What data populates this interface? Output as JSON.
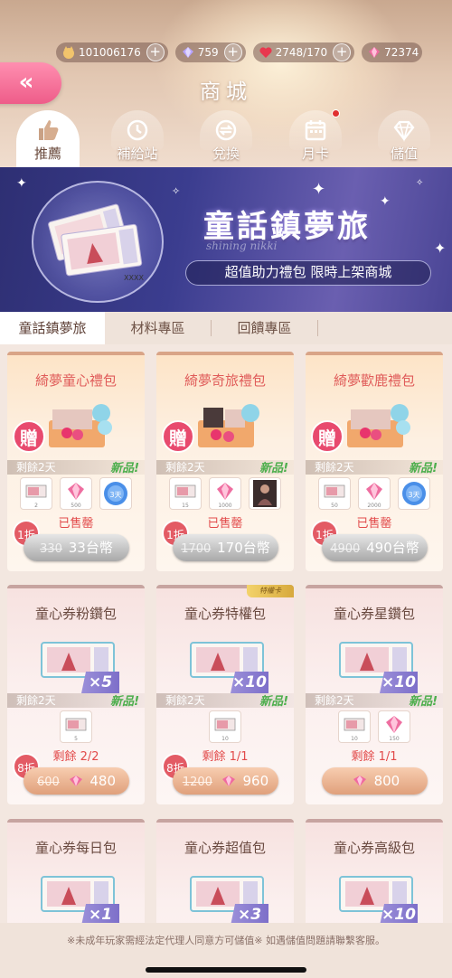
{
  "currency": {
    "player_id": "101006176",
    "diamonds": "759",
    "stamina": "2748/170",
    "pink_diamonds": "72374",
    "plus_symbol": "+"
  },
  "header": {
    "back_symbol": "«",
    "title": "商城"
  },
  "main_tabs": [
    {
      "label": "推薦",
      "icon": "thumbs-up-icon",
      "active": true
    },
    {
      "label": "補給站",
      "icon": "clock-icon",
      "active": false
    },
    {
      "label": "兌換",
      "icon": "exchange-icon",
      "active": false
    },
    {
      "label": "月卡",
      "icon": "calendar-icon",
      "active": false,
      "badge": true
    },
    {
      "label": "儲值",
      "icon": "diamond-icon",
      "active": false
    }
  ],
  "banner": {
    "title": "童話鎮夢旅",
    "script_text": "shining nikki",
    "subtitle": "超值助力禮包 限時上架商城",
    "ticket_text": "XXXX"
  },
  "sub_tabs": [
    {
      "label": "童話鎮夢旅",
      "active": true
    },
    {
      "label": "材料專區",
      "active": false
    },
    {
      "label": "回饋專區",
      "active": false
    }
  ],
  "packs_row1": [
    {
      "title": "綺夢童心禮包",
      "gift_badge": "贈",
      "remaining": "剩餘2天",
      "new_label": "新品!",
      "items": [
        {
          "icon": "ticket-icon",
          "qty": "2"
        },
        {
          "icon": "pink-diamond-icon",
          "qty": "500"
        },
        {
          "icon": "blue-badge-icon",
          "qty": "3天"
        }
      ],
      "status": "已售罄",
      "discount": "1折",
      "old_price": "330",
      "price": "33台幣"
    },
    {
      "title": "綺夢奇旅禮包",
      "gift_badge": "贈",
      "remaining": "剩餘2天",
      "new_label": "新品!",
      "items": [
        {
          "icon": "ticket-icon",
          "qty": "15"
        },
        {
          "icon": "pink-diamond-icon",
          "qty": "1000"
        },
        {
          "icon": "character-card-icon",
          "qty": ""
        }
      ],
      "status": "已售罄",
      "discount": "1折",
      "old_price": "1700",
      "price": "170台幣"
    },
    {
      "title": "綺夢歡鹿禮包",
      "gift_badge": "贈",
      "remaining": "剩餘2天",
      "new_label": "新品!",
      "items": [
        {
          "icon": "ticket-icon",
          "qty": "50"
        },
        {
          "icon": "pink-diamond-icon",
          "qty": "2000"
        },
        {
          "icon": "blue-badge-icon",
          "qty": "3天"
        }
      ],
      "status": "已售罄",
      "discount": "1折",
      "old_price": "4900",
      "price": "490台幣"
    }
  ],
  "packs_row2": [
    {
      "title": "童心券粉鑽包",
      "multiplier": "×5",
      "remaining": "剩餘2天",
      "new_label": "新品!",
      "item_icon": "ticket-icon",
      "item_qty": "5",
      "remain_count": "剩餘 2/2",
      "discount": "8折",
      "old_price": "600",
      "price": "480"
    },
    {
      "title": "童心券特權包",
      "ribbon": "特權卡",
      "multiplier": "×10",
      "remaining": "剩餘2天",
      "new_label": "新品!",
      "item_icon": "ticket-icon",
      "item_qty": "10",
      "remain_count": "剩餘 1/1",
      "discount": "8折",
      "old_price": "1200",
      "price": "960"
    },
    {
      "title": "童心券星鑽包",
      "multiplier": "×10",
      "remaining": "剩餘2天",
      "new_label": "新品!",
      "item_icons": [
        "ticket-icon",
        "pink-diamond-icon"
      ],
      "item_qtys": [
        "10",
        "150"
      ],
      "remain_count": "剩餘 1/1",
      "price": "800"
    }
  ],
  "packs_row3": [
    {
      "title": "童心券每日包",
      "multiplier": "×1"
    },
    {
      "title": "童心券超值包",
      "multiplier": "×3"
    },
    {
      "title": "童心券高級包",
      "multiplier": "×10"
    }
  ],
  "footer": {
    "notice": "※未成年玩家需經法定代理人同意方可儲值※ 如遇儲值問題請聯繫客服。"
  },
  "colors": {
    "accent_pink": "#ee5c89",
    "title_red": "#e05c5a",
    "new_green": "#4cae4c",
    "discount_red": "#e35b65"
  }
}
